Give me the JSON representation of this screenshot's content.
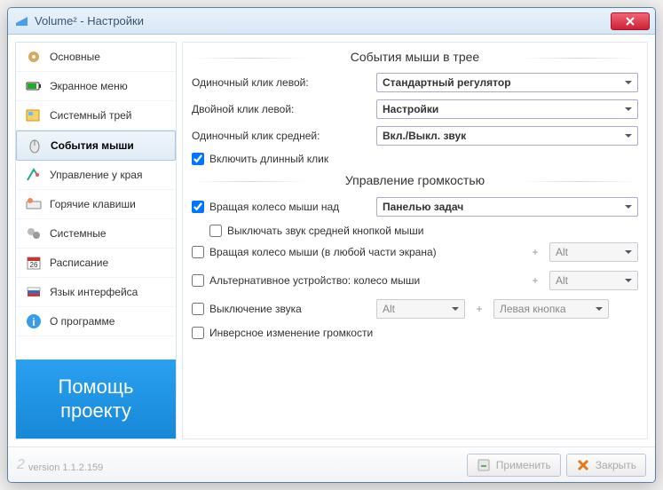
{
  "titlebar": {
    "title": "Volume² - Настройки"
  },
  "sidebar": {
    "items": [
      {
        "label": "Основные"
      },
      {
        "label": "Экранное меню"
      },
      {
        "label": "Системный трей"
      },
      {
        "label": "События мыши"
      },
      {
        "label": "Управление у края"
      },
      {
        "label": "Горячие клавиши"
      },
      {
        "label": "Системные"
      },
      {
        "label": "Расписание"
      },
      {
        "label": "Язык интерфейса"
      },
      {
        "label": "О программе"
      }
    ],
    "donate_line1": "Помощь",
    "donate_line2": "проекту"
  },
  "sections": {
    "tray_title": "События мыши в трее",
    "single_left_label": "Одиночный клик левой:",
    "single_left_value": "Стандартный регулятор",
    "double_left_label": "Двойной клик левой:",
    "double_left_value": "Настройки",
    "single_middle_label": "Одиночный клик средней:",
    "single_middle_value": "Вкл./Выкл. звук",
    "long_click_label": "Включить длинный клик",
    "volume_title": "Управление громкостью",
    "wheel_over_label": "Вращая колесо мыши над",
    "wheel_over_value": "Панелью задач",
    "mute_middle_label": "Выключать звук средней кнопкой мыши",
    "wheel_anywhere_label": "Вращая колесо мыши (в любой части экрана)",
    "wheel_anywhere_key": "Alt",
    "alt_device_label": "Альтернативное устройство: колесо мыши",
    "alt_device_key": "Alt",
    "mute_label": "Выключение звука",
    "mute_key1": "Alt",
    "mute_key2": "Левая кнопка",
    "inverse_label": "Инверсное изменение громкости"
  },
  "footer": {
    "version_num": "2",
    "version": "version 1.1.2.159",
    "apply": "Применить",
    "close": "Закрыть"
  }
}
